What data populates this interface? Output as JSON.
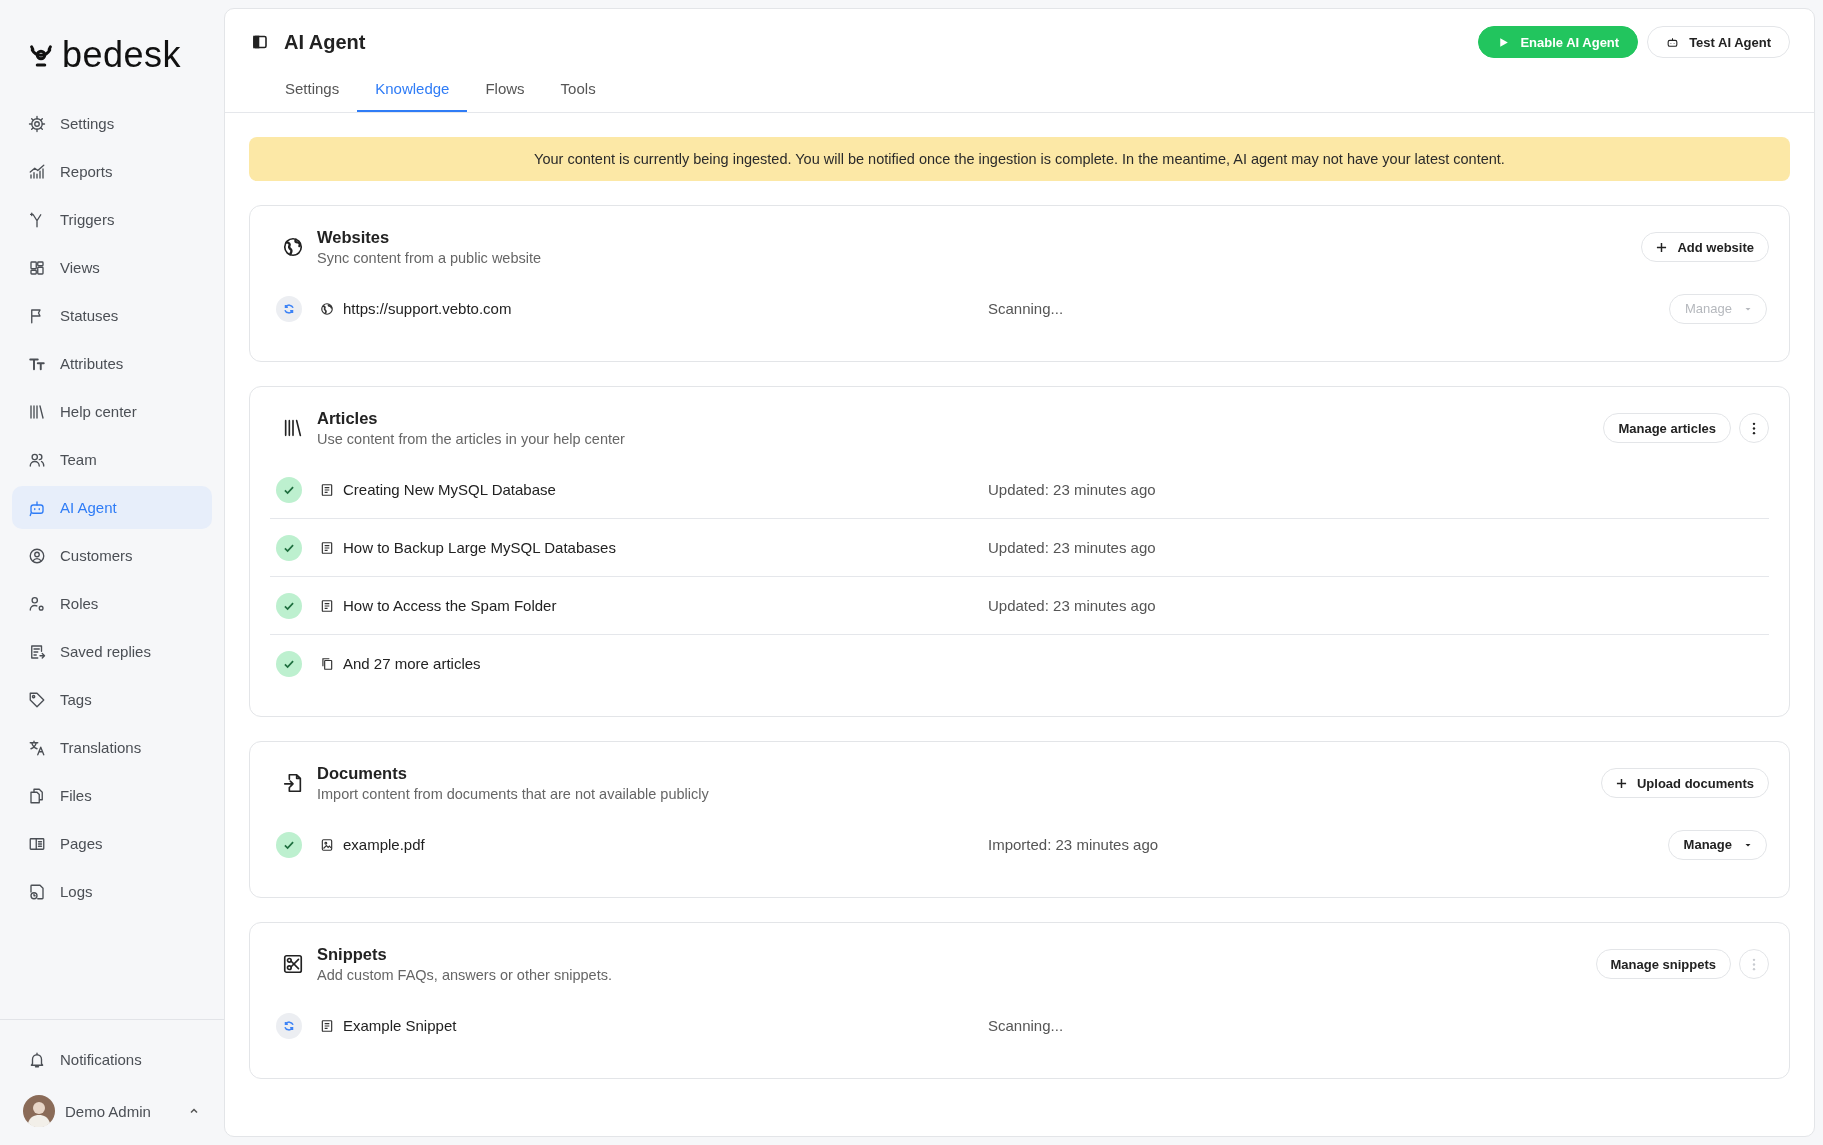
{
  "logo": {
    "text": "bedesk"
  },
  "sidebar": {
    "items": [
      {
        "label": "Settings",
        "selected": false
      },
      {
        "label": "Reports",
        "selected": false
      },
      {
        "label": "Triggers",
        "selected": false
      },
      {
        "label": "Views",
        "selected": false
      },
      {
        "label": "Statuses",
        "selected": false
      },
      {
        "label": "Attributes",
        "selected": false
      },
      {
        "label": "Help center",
        "selected": false
      },
      {
        "label": "Team",
        "selected": false
      },
      {
        "label": "AI Agent",
        "selected": true
      },
      {
        "label": "Customers",
        "selected": false
      },
      {
        "label": "Roles",
        "selected": false
      },
      {
        "label": "Saved replies",
        "selected": false
      },
      {
        "label": "Tags",
        "selected": false
      },
      {
        "label": "Translations",
        "selected": false
      },
      {
        "label": "Files",
        "selected": false
      },
      {
        "label": "Pages",
        "selected": false
      },
      {
        "label": "Logs",
        "selected": false
      }
    ],
    "notifications": {
      "label": "Notifications"
    },
    "user": {
      "name": "Demo Admin"
    }
  },
  "header": {
    "title": "AI Agent",
    "buttons": [
      {
        "label": "Enable AI Agent",
        "kind": "primary"
      },
      {
        "label": "Test AI Agent",
        "kind": "secondary"
      }
    ]
  },
  "tabs": [
    {
      "label": "Settings",
      "selected": false
    },
    {
      "label": "Knowledge",
      "selected": true
    },
    {
      "label": "Flows",
      "selected": false
    },
    {
      "label": "Tools",
      "selected": false
    }
  ],
  "banner": {
    "text": "Your content is currently being ingested. You will be notified once the ingestion is complete. In the meantime, AI agent may not have your latest content."
  },
  "sections": [
    {
      "title": "Websites",
      "subtitle": "Sync content from a public website",
      "actions": [
        {
          "kind": "add",
          "label": "Add website"
        }
      ],
      "items": [
        {
          "synced": false,
          "kind": "url",
          "name": "https://support.vebto.com",
          "info": "Scanning...",
          "action": {
            "label": "Manage",
            "disabled": true
          }
        }
      ]
    },
    {
      "title": "Articles",
      "subtitle": "Use content from the articles in your help center",
      "actions": [
        {
          "kind": "plain",
          "label": "Manage articles"
        },
        {
          "kind": "more",
          "disabled": false
        }
      ],
      "items": [
        {
          "synced": true,
          "kind": "article",
          "name": "Creating New MySQL Database",
          "info": "Updated: 23 minutes ago"
        },
        {
          "synced": true,
          "kind": "article",
          "name": "How to Backup Large MySQL Databases",
          "info": "Updated: 23 minutes ago"
        },
        {
          "synced": true,
          "kind": "article",
          "name": "How to Access the Spam Folder",
          "info": "Updated: 23 minutes ago"
        },
        {
          "synced": true,
          "kind": "more",
          "name": "And 27 more articles"
        }
      ]
    },
    {
      "title": "Documents",
      "subtitle": "Import content from documents that are not available publicly",
      "actions": [
        {
          "kind": "add",
          "label": "Upload documents"
        }
      ],
      "items": [
        {
          "synced": true,
          "kind": "file",
          "name": "example.pdf",
          "info": "Imported: 23 minutes ago",
          "action": {
            "label": "Manage",
            "disabled": false
          }
        }
      ]
    },
    {
      "title": "Snippets",
      "subtitle": "Add custom FAQs, answers or other snippets.",
      "actions": [
        {
          "kind": "plain",
          "label": "Manage snippets"
        },
        {
          "kind": "more",
          "disabled": true
        }
      ],
      "items": [
        {
          "synced": false,
          "kind": "article",
          "name": "Example Snippet",
          "info": "Scanning..."
        }
      ]
    }
  ]
}
